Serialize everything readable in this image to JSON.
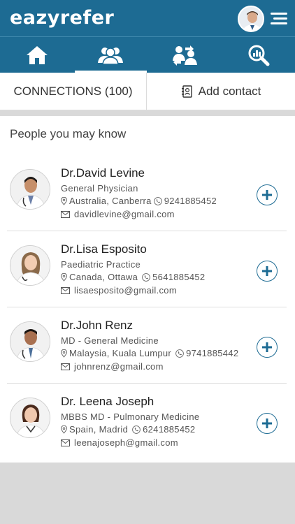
{
  "app": {
    "logo": "eazyrefer"
  },
  "tabs": [
    {
      "name": "home",
      "icon": "home-icon"
    },
    {
      "name": "connections",
      "icon": "people-icon",
      "active": true
    },
    {
      "name": "referrals",
      "icon": "referral-icon"
    },
    {
      "name": "search",
      "icon": "search-analytics-icon"
    }
  ],
  "subbar": {
    "connections_label": "CONNECTIONS (100)",
    "add_contact_label": "Add contact"
  },
  "section": {
    "title": "People you may know"
  },
  "people": [
    {
      "name": "Dr.David Levine",
      "specialty": "General Physician",
      "location": "Australia, Canberra",
      "phone": "9241885452",
      "email": "davidlevine@gmail.com"
    },
    {
      "name": "Dr.Lisa Esposito",
      "specialty": "Paediatric Practice",
      "location": "Canada, Ottawa",
      "phone": "5641885452",
      "email": "lisaesposito@gmail.com"
    },
    {
      "name": "Dr.John Renz",
      "specialty": "MD - General Medicine",
      "location": "Malaysia, Kuala Lumpur",
      "phone": "9741885442",
      "email": "johnrenz@gmail.com"
    },
    {
      "name": "Dr. Leena Joseph",
      "specialty": "MBBS MD - Pulmonary Medicine",
      "location": "Spain, Madrid",
      "phone": "6241885452",
      "email": "leenajoseph@gmail.com"
    }
  ],
  "colors": {
    "primary": "#1d6b93",
    "divider": "#dddddd",
    "footer": "#d9d9d9"
  }
}
